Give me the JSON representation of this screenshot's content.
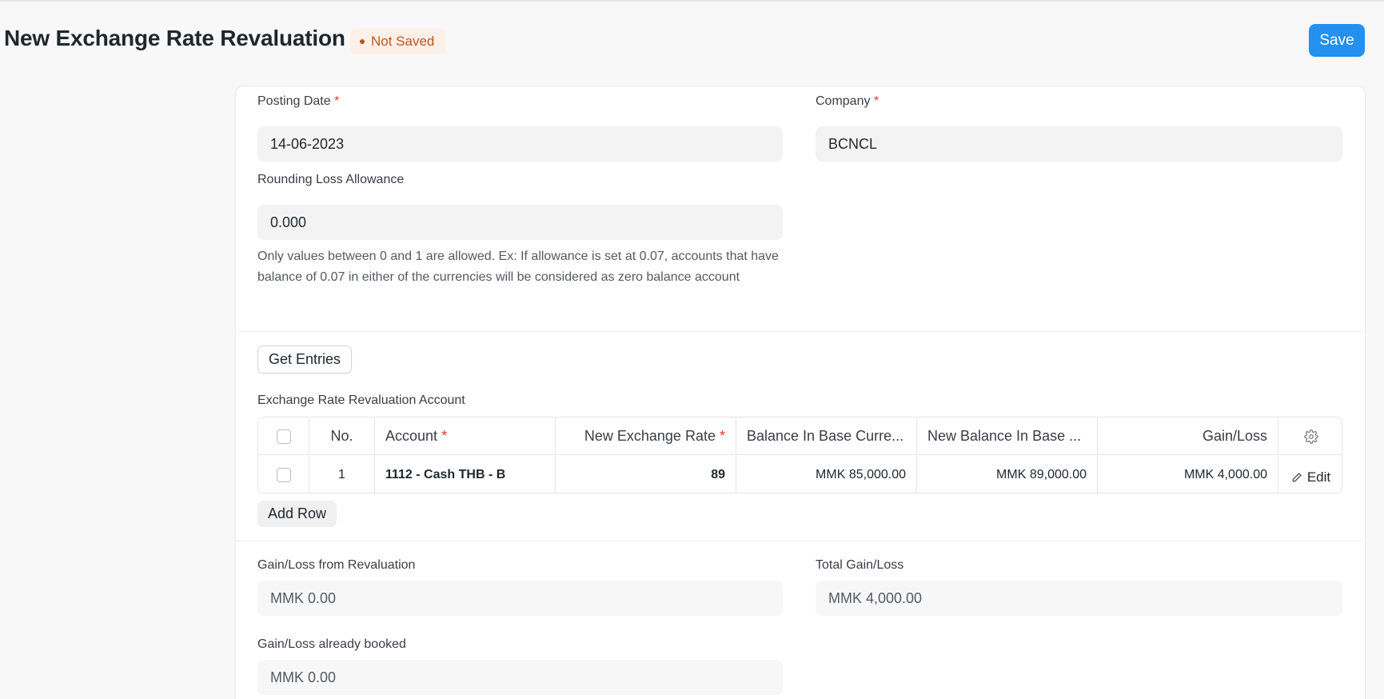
{
  "header": {
    "title": "New Exchange Rate Revaluation",
    "status": "Not Saved",
    "save_label": "Save"
  },
  "form": {
    "posting_date": {
      "label": "Posting Date",
      "required": "*",
      "value": "14-06-2023"
    },
    "company": {
      "label": "Company",
      "required": "*",
      "value": "BCNCL"
    },
    "rounding_loss": {
      "label": "Rounding Loss Allowance",
      "value": "0.000",
      "help": "Only values between 0 and 1 are allowed. Ex: If allowance is set at 0.07, accounts that have balance of 0.07 in either of the currencies will be considered as zero balance account"
    },
    "get_entries_label": "Get Entries",
    "table_label": "Exchange Rate Revaluation Account",
    "add_row_label": "Add Row",
    "gain_loss_revaluation": {
      "label": "Gain/Loss from Revaluation",
      "value": "MMK 0.00"
    },
    "total_gain_loss": {
      "label": "Total Gain/Loss",
      "value": "MMK 4,000.00"
    },
    "gain_loss_booked": {
      "label": "Gain/Loss already booked",
      "value": "MMK 0.00"
    }
  },
  "table": {
    "columns": {
      "no": "No.",
      "account": "Account",
      "account_req": "*",
      "new_rate": "New Exchange Rate",
      "new_rate_req": "*",
      "balance_base": "Balance In Base Curre...",
      "new_balance_base": "New Balance In Base ...",
      "gain_loss": "Gain/Loss"
    },
    "rows": [
      {
        "no": "1",
        "account": "1112 - Cash THB - B",
        "new_rate": "89",
        "balance_base": "MMK 85,000.00",
        "new_balance_base": "MMK 89,000.00",
        "gain_loss": "MMK 4,000.00",
        "edit_label": "Edit"
      }
    ]
  },
  "icons": {
    "settings": "gear-icon",
    "edit": "pencil-icon",
    "status": "dot-icon"
  },
  "colors": {
    "primary": "#2490ef",
    "status_bg": "#fdf0e8",
    "status_fg": "#c0541c",
    "required": "#e03636"
  }
}
